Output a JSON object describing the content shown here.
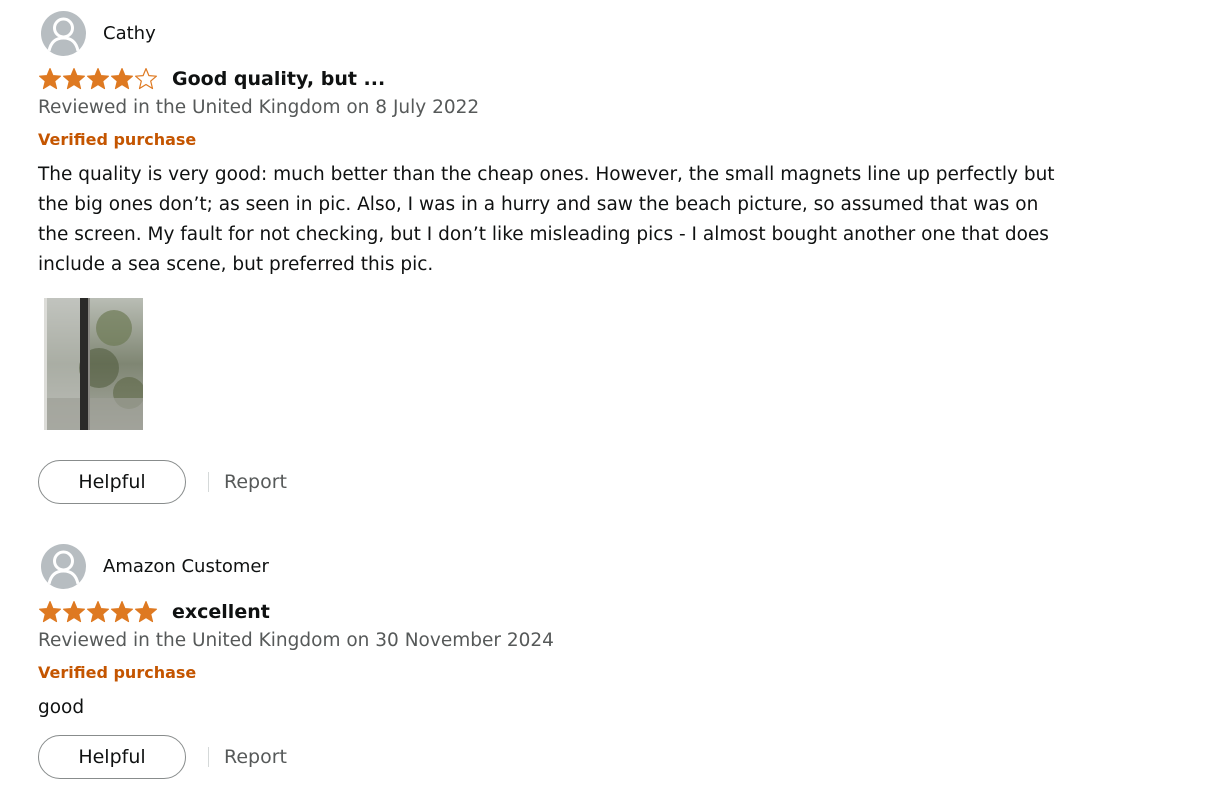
{
  "colors": {
    "star_fill": "#de7921",
    "verified": "#c45500",
    "secondary_text": "#565959",
    "avatar_bg": "#b7bdc1"
  },
  "reviews": [
    {
      "author": "Cathy",
      "rating": 4,
      "rating_max": 5,
      "title": "Good quality, but ...",
      "date_text": "Reviewed in the United Kingdom on 8 July 2022",
      "verified_label": "Verified purchase",
      "body": "The quality is very good: much better than the cheap ones. However, the small magnets line up perfectly but the big ones don’t; as seen in pic. Also, I was in a hurry and saw the beach picture, so assumed that was on the screen. My fault for not checking, but I don’t like misleading pics - I almost bought another one that does include a sea scene, but preferred this pic.",
      "has_image": true,
      "helpful_label": "Helpful",
      "report_label": "Report"
    },
    {
      "author": "Amazon Customer",
      "rating": 5,
      "rating_max": 5,
      "title": "excellent",
      "date_text": "Reviewed in the United Kingdom on 30 November 2024",
      "verified_label": "Verified purchase",
      "body": "good",
      "has_image": false,
      "helpful_label": "Helpful",
      "report_label": "Report"
    }
  ]
}
